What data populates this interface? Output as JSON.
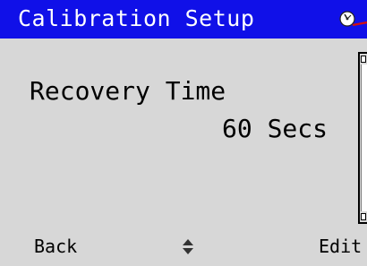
{
  "header": {
    "title": "Calibration Setup",
    "status_icon": "gauge-icon",
    "bar_color": "#1010e8"
  },
  "field": {
    "label": "Recovery Time",
    "value": "60 Secs"
  },
  "softkeys": {
    "left_label": "Back",
    "center_icon": "up-down-arrows-icon",
    "right_label": "Edit"
  },
  "colors": {
    "background": "#d7d7d7",
    "title_text": "#ffffff",
    "status_accent": "#d01010"
  }
}
